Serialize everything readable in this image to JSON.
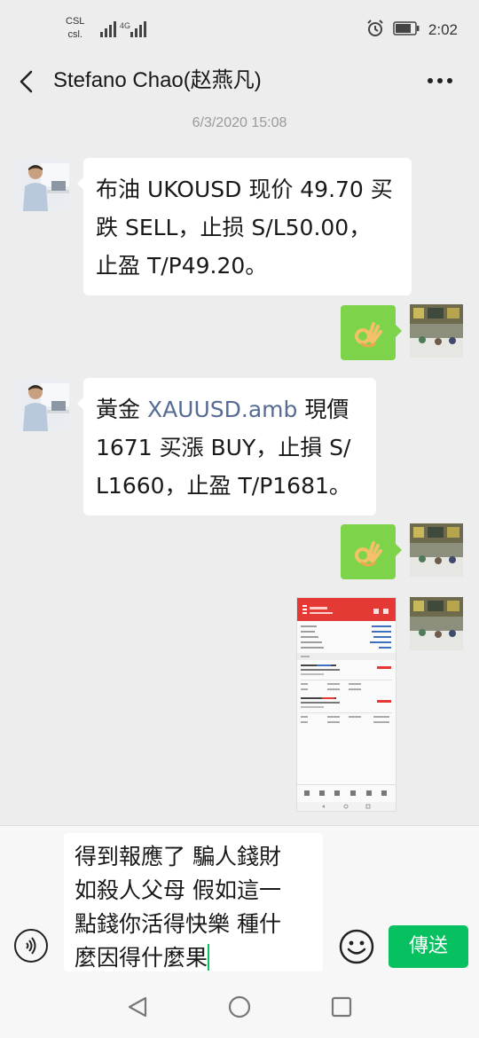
{
  "status_bar": {
    "carrier_top": "CSL",
    "carrier_bottom": "csl.",
    "network": "4G",
    "time": "2:02",
    "icons": [
      "signal-icon",
      "alarm-icon",
      "battery-icon"
    ]
  },
  "header": {
    "title": "Stefano Chao(赵燕凡)",
    "back_icon": "chevron-left-icon",
    "more_icon": "more-dots-icon"
  },
  "chat": {
    "timestamp": "6/3/2020 15:08",
    "messages": [
      {
        "side": "left",
        "lines": [
          "布油 UKOUSD 现价 49.70 买",
          "跌 SELL，止损 S/L50.00，",
          "止盈 T/P49.20。"
        ]
      },
      {
        "side": "right",
        "type": "sticker",
        "icon": "ok-hand-icon"
      },
      {
        "side": "left",
        "line1_prefix": "黃金 ",
        "line1_link": "XAUUSD.amb",
        "line1_suffix": " 現價",
        "lines_rest": [
          "1671 买漲 BUY，止損 S/",
          "L1660，止盈 T/P1681。"
        ]
      },
      {
        "side": "right",
        "type": "sticker",
        "icon": "ok-hand-icon"
      },
      {
        "side": "right",
        "type": "image",
        "description": "trading-app-screenshot"
      }
    ]
  },
  "input": {
    "lines": [
      "得到報應了 騙人錢財",
      "如殺人父母 假如這一",
      "點錢你活得快樂 種什",
      "麼因得什麼果"
    ],
    "voice_icon": "voice-icon",
    "emoji_icon": "emoji-icon",
    "send_label": "傳送"
  },
  "system_nav": [
    "back-triangle-icon",
    "home-circle-icon",
    "recents-square-icon"
  ],
  "colors": {
    "accent": "#07c160",
    "link": "#576b95",
    "sticker_bg": "#7dd44a",
    "background": "#ededed"
  }
}
